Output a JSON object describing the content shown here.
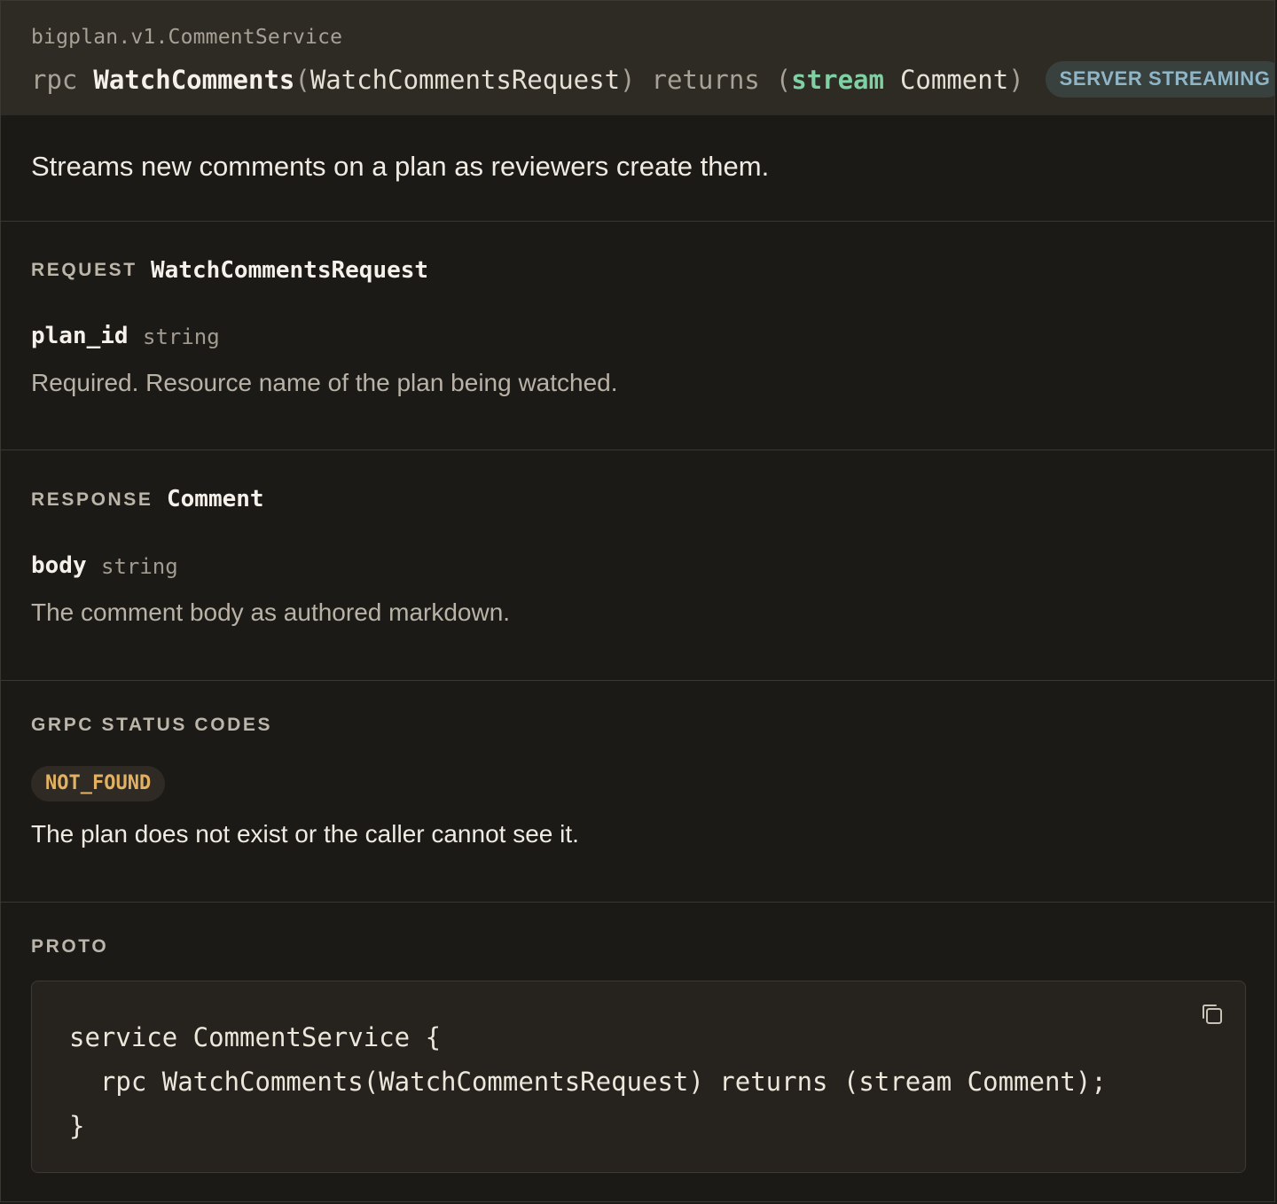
{
  "header": {
    "service_path": "bigplan.v1.CommentService",
    "rpc_keyword": "rpc",
    "method_name": "WatchComments",
    "open_paren": "(",
    "request_type": "WatchCommentsRequest",
    "close_paren": ")",
    "returns_keyword": "returns",
    "returns_open_paren": "(",
    "stream_keyword": "stream",
    "response_type": "Comment",
    "returns_close_paren": ")",
    "badge": "SERVER STREAMING"
  },
  "description": "Streams new comments on a plan as reviewers create them.",
  "request": {
    "label": "REQUEST",
    "type": "WatchCommentsRequest",
    "field_name": "plan_id",
    "field_type": "string",
    "field_desc": "Required. Resource name of the plan being watched."
  },
  "response": {
    "label": "RESPONSE",
    "type": "Comment",
    "field_name": "body",
    "field_type": "string",
    "field_desc": "The comment body as authored markdown."
  },
  "status_codes": {
    "label": "GRPC STATUS CODES",
    "code": "NOT_FOUND",
    "code_desc": "The plan does not exist or the caller cannot see it."
  },
  "proto": {
    "label": "PROTO",
    "line1": "service CommentService {",
    "line2": "  rpc WatchComments(WatchCommentsRequest) returns (stream Comment);",
    "line3": "}",
    "copy_icon": "copy-icon"
  },
  "colors": {
    "stream_keyword": "#7fd0a3",
    "badge_text": "#8fb6c8",
    "status_code": "#e2b262",
    "background": "#1c1a17",
    "header_bg": "#2e2a24"
  }
}
